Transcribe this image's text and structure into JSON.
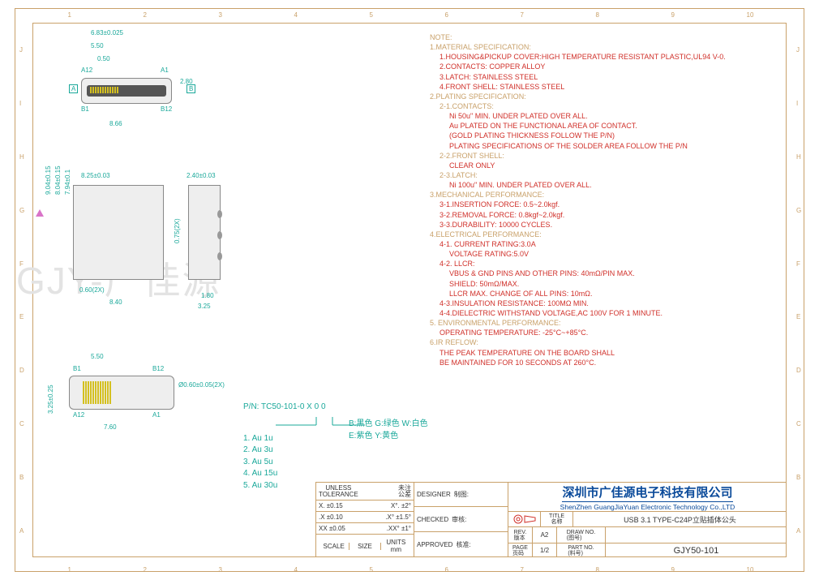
{
  "ruler_cols": [
    "1",
    "2",
    "3",
    "4",
    "5",
    "6",
    "7",
    "8",
    "9",
    "10"
  ],
  "ruler_rows": [
    "J",
    "I",
    "H",
    "G",
    "F",
    "E",
    "D",
    "C",
    "B",
    "A"
  ],
  "dims": {
    "top_w1": "6.83±0.025",
    "top_w2": "5.50",
    "top_w3": "0.50",
    "top_w4": "8.66",
    "top_h1": "2.80",
    "pinA12": "A12",
    "pinA1": "A1",
    "pinB1": "B1",
    "pinB12": "B12",
    "datumA": "A",
    "datumB": "B",
    "mid_w1": "8.25±0.03",
    "mid_w2": "2.40±0.03",
    "mid_w3": "8.40",
    "mid_h1": "9.04±0.15",
    "mid_h2": "8.04±0.15",
    "mid_h3": "7.94±0.1",
    "mid_h4": "0.75(2X)",
    "mid_h5": "0.60(2X)",
    "mid_w4": "1.80",
    "mid_w5": "3.25",
    "bot_w1": "5.50",
    "bot_w2": "7.60",
    "bot_h1": "3.25±0.25",
    "bot_d1": "Ø0.60±0.05(2X)"
  },
  "notes": {
    "head": "NOTE:",
    "s1": "1.MATERIAL SPECIFICATION:",
    "s1_1": "1.HOUSING&PICKUP COVER:HIGH TEMPERATURE RESISTANT PLASTIC,UL94 V-0.",
    "s1_2": "2.CONTACTS: COPPER ALLOY",
    "s1_3": "3.LATCH: STAINLESS STEEL",
    "s1_4": "4.FRONT SHELL: STAINLESS STEEL",
    "s2": "2.PLATING SPECIFICATION:",
    "s2_1": "2-1.CONTACTS:",
    "s2_1a": "Ni 50u\" MIN. UNDER PLATED OVER ALL.",
    "s2_1b": "Au PLATED ON THE FUNCTIONAL AREA OF CONTACT.",
    "s2_1c": "(GOLD PLATING THICKNESS FOLLOW THE P/N)",
    "s2_1d": "PLATING SPECIFICATIONS OF THE SOLDER AREA FOLLOW THE P/N",
    "s2_2": "2-2.FRONT SHELL:",
    "s2_2a": "CLEAR ONLY",
    "s2_3": "2-3.LATCH:",
    "s2_3a": "Ni 100u\" MIN. UNDER PLATED OVER ALL.",
    "s3": "3.MECHANICAL PERFORMANCE:",
    "s3_1": "3-1.INSERTION FORCE: 0.5~2.0kgf.",
    "s3_2": "3-2.REMOVAL FORCE: 0.8kgf~2.0kgf.",
    "s3_3": "3-3.DURABILITY: 10000 CYCLES.",
    "s4": "4.ELECTRICAL PERFORMANCE:",
    "s4_1": "4-1. CURRENT RATING:3.0A",
    "s4_1a": "VOLTAGE RATING:5.0V",
    "s4_2": "4-2. LLCR:",
    "s4_2a": "VBUS & GND PINS AND OTHER PINS: 40mΩ/PIN MAX.",
    "s4_2b": "SHIELD: 50mΩ/MAX.",
    "s4_2c": "LLCR MAX. CHANGE OF ALL PINS: 10mΩ.",
    "s4_3": "4-3.INSULATION RESISTANCE: 100MΩ MIN.",
    "s4_4": "4-4.DIELECTRIC WITHSTAND VOLTAGE,AC 100V FOR 1 MINUTE.",
    "s5": "5. ENVIRONMENTAL PERFORMANCE:",
    "s5_1": "OPERATING TEMPERATURE: -25°C~+85°C.",
    "s6": "6.IR REFLOW:",
    "s6_1": "THE PEAK TEMPERATURE ON THE BOARD SHALL",
    "s6_2": "BE MAINTAINED FOR 10 SECONDS AT 260°C."
  },
  "pn": {
    "label": "P/N: TC50-101-0 X 0 0",
    "opts": [
      "1. Au 1u",
      "2. Au 3u",
      "3. Au 5u",
      "4. Au 15u",
      "5. Au 30u"
    ]
  },
  "colors": {
    "l1": "B:黑色  G:绿色  W:白色",
    "l2": "E:紫色  Y:黄色"
  },
  "titleblock": {
    "tol_head": "UNLESS\nTOLERANCE",
    "tol_head_cn": "未注\n公差",
    "tol1a": "X. ±0.15",
    "tol1b": "X°. ±2°",
    "tol2a": ".X ±0.10",
    "tol2b": ".X° ±1.5°",
    "tol3a": "XX ±0.05",
    "tol3b": ".XX° ±1°",
    "scale_l": "SCALE",
    "size_l": "SIZE",
    "units_l": "UNITS",
    "units_v": "mm",
    "designer_l": "DESIGNER",
    "designer_cn": "制图:",
    "checked_l": "CHECKED",
    "checked_cn": "审核:",
    "approved_l": "APPROVED",
    "approved_cn": "核准:",
    "company_cn": "深圳市广佳源电子科技有限公司",
    "company_en": "ShenZhen GuangJiaYuan Electronic Technology Co.,LTD",
    "title_l": "TITLE\n名称",
    "title_v": "USB 3.1 TYPE-C24P立贴插体公头",
    "rev_l": "REV.\n版本",
    "rev_v": "A2",
    "draw_l": "DRAW NO.\n(图号)",
    "page_l": "PAGE\n页码",
    "page_v": "1/2",
    "part_l": "PART NO.\n(料号)",
    "part_v": "GJY50-101"
  },
  "watermark": "GJY-广佳源"
}
